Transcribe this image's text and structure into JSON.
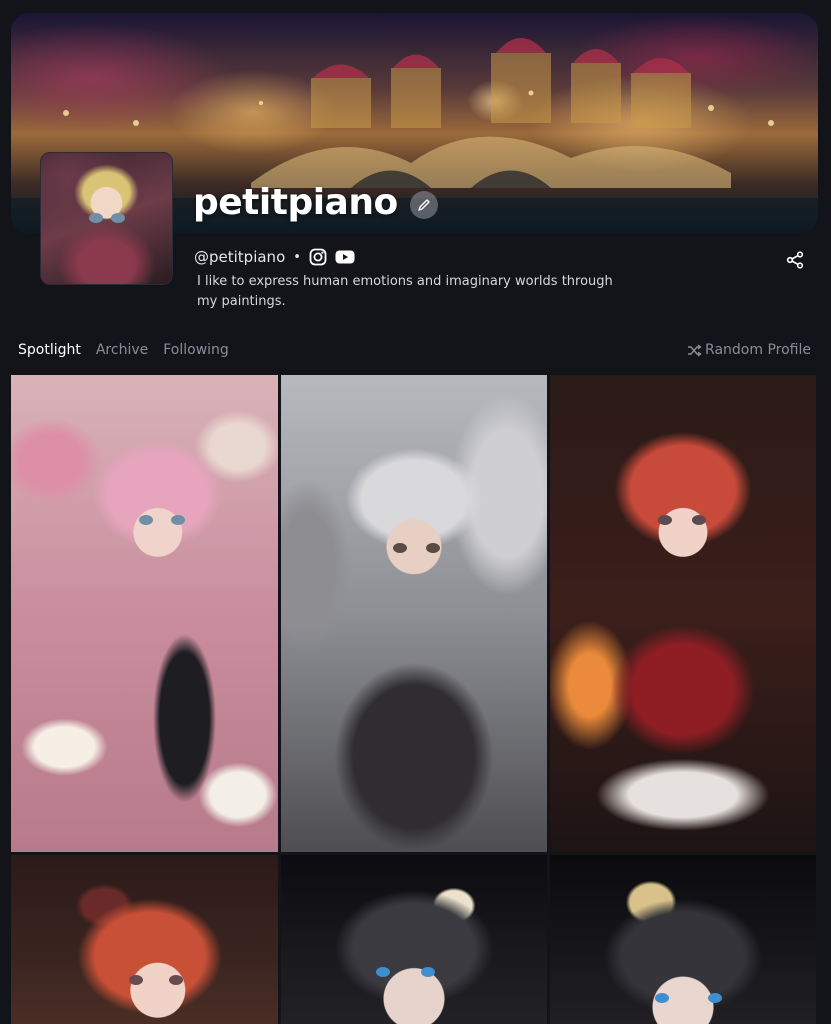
{
  "profile": {
    "display_name": "petitpiano",
    "handle": "@petitpiano",
    "separator": "•",
    "bio": "I like to express human emotions and imaginary worlds through my paintings."
  },
  "icons": {
    "edit": "pencil-icon",
    "instagram": "instagram-icon",
    "youtube": "youtube-icon",
    "share": "share-icon",
    "random": "shuffle-icon"
  },
  "tabs": [
    {
      "label": "Spotlight",
      "active": true
    },
    {
      "label": "Archive",
      "active": false
    },
    {
      "label": "Following",
      "active": false
    }
  ],
  "random_profile_label": "Random Profile",
  "colors": {
    "background": "#121419",
    "active_tab": "#ffffff",
    "inactive_tab": "#8a8d99"
  }
}
